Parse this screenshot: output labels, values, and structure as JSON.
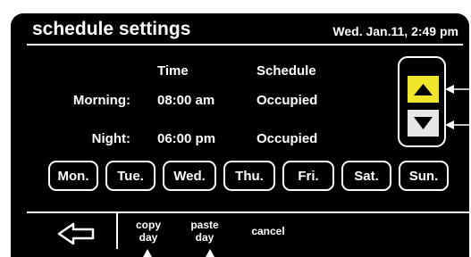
{
  "header": {
    "title": "schedule settings",
    "datetime": "Wed. Jan.11, 2:49 pm"
  },
  "table": {
    "columns": [
      "Time",
      "Schedule"
    ],
    "rows": [
      {
        "label": "Morning:",
        "time": "08:00 am",
        "schedule": "Occupied"
      },
      {
        "label": "Night:",
        "time": "06:00 pm",
        "schedule": "Occupied"
      }
    ]
  },
  "arrows": {
    "up": {
      "icon": "up-triangle-icon",
      "color": "#f2e62a"
    },
    "down": {
      "icon": "down-triangle-icon",
      "color": "#e6e6e6"
    }
  },
  "days": [
    "Mon.",
    "Tue.",
    "Wed.",
    "Thu.",
    "Fri.",
    "Sat.",
    "Sun."
  ],
  "footer": {
    "back_icon": "left-arrow-icon",
    "copy_line1": "copy",
    "copy_line2": "day",
    "paste_line1": "paste",
    "paste_line2": "day",
    "cancel": "cancel"
  },
  "colors": {
    "screen": "#000000",
    "text": "#ffffff",
    "accent": "#f2e62a"
  }
}
